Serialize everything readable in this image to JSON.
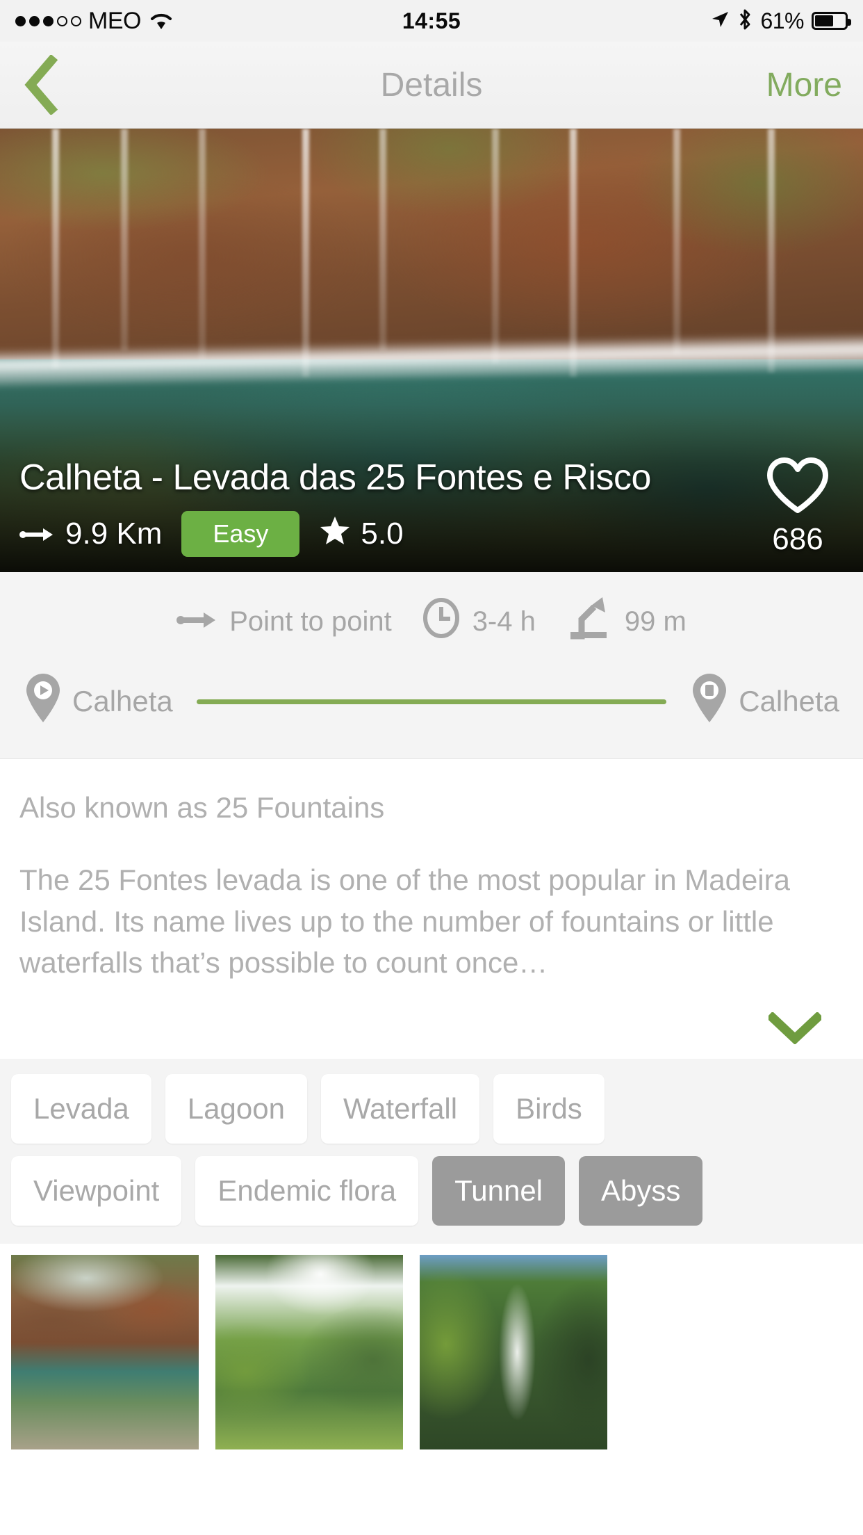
{
  "status_bar": {
    "carrier": "MEO",
    "signal_filled": 3,
    "signal_total": 5,
    "time": "14:55",
    "battery_percent": "61%",
    "battery_level": 61,
    "icons": [
      "location-arrow-icon",
      "bluetooth-icon",
      "wifi-icon"
    ]
  },
  "nav_bar": {
    "back_label": "",
    "title": "Details",
    "more_label": "More",
    "accent_color": "#82ab5e"
  },
  "hero": {
    "title": "Calheta - Levada das 25 Fontes e Risco",
    "distance": "9.9 Km",
    "difficulty": "Easy",
    "difficulty_color": "#6cb044",
    "rating": "5.0",
    "favorites": "686"
  },
  "stats": {
    "route_type": "Point to point",
    "duration": "3-4 h",
    "elevation": "99 m",
    "start_point": "Calheta",
    "end_point": "Calheta",
    "line_color": "#84ab54"
  },
  "description": {
    "alias": "Also known as 25 Fountains",
    "body": "The 25 Fontes levada is one of the most popular in Madeira Island. Its name lives up to the number of fountains or little waterfalls that’s possible to count once…"
  },
  "tags": {
    "rows": [
      [
        {
          "label": "Levada",
          "selected": false
        },
        {
          "label": "Lagoon",
          "selected": false
        },
        {
          "label": "Waterfall",
          "selected": false
        },
        {
          "label": "Birds",
          "selected": false
        }
      ],
      [
        {
          "label": "Viewpoint",
          "selected": false
        },
        {
          "label": "Endemic flora",
          "selected": false
        },
        {
          "label": "Tunnel",
          "selected": true
        },
        {
          "label": "Abyss",
          "selected": true
        }
      ]
    ]
  },
  "gallery": {
    "items": [
      {
        "name": "photo-waterfall-pool"
      },
      {
        "name": "photo-valley-ridge"
      },
      {
        "name": "photo-tall-waterfall"
      }
    ]
  }
}
